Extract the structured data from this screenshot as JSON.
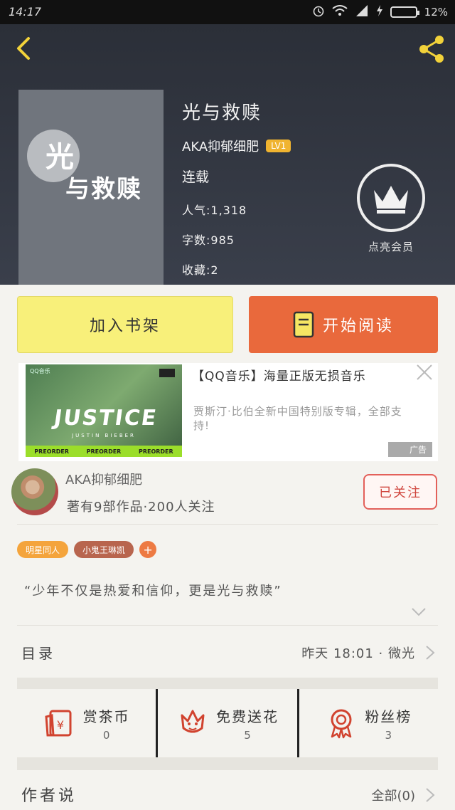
{
  "status_bar": {
    "time": "14:17",
    "battery": "12%"
  },
  "book": {
    "title": "光与救赎",
    "cover_line1": "光",
    "cover_line2": "与救赎",
    "author": "AKA抑郁细肥",
    "level": "LV1",
    "status": "连载",
    "popularity": "人气:1,318",
    "word_count": "字数:985",
    "favorites": "收藏:2"
  },
  "vip": {
    "label": "点亮会员"
  },
  "actions": {
    "add_shelf": "加入书架",
    "start_reading": "开始阅读"
  },
  "ad": {
    "title": "【QQ音乐】海量正版无损音乐",
    "description": "贾斯汀·比伯全新中国特别版专辑，全部支持!",
    "tag": "广告",
    "image_text": {
      "brand": "QQ音乐",
      "word": "JUSTICE",
      "artist": "JUSTIN BIEBER",
      "preorder": [
        "PREORDER",
        "PREORDER",
        "PREORDER"
      ]
    }
  },
  "author_card": {
    "name": "AKA抑郁细肥",
    "works": "著有9部作品·200人关注",
    "follow_label": "已关注"
  },
  "tags": [
    "明星同人",
    "小鬼王琳凯"
  ],
  "tag_add": "+",
  "quote": "“少年不仅是热爱和信仰，更是光与救赎”",
  "toc": {
    "label": "目录",
    "latest": "昨天 18:01 · 微光"
  },
  "stats": [
    {
      "label": "赏茶币",
      "value": "0",
      "icon": "red-envelope-icon"
    },
    {
      "label": "免费送花",
      "value": "5",
      "icon": "flower-icon"
    },
    {
      "label": "粉丝榜",
      "value": "3",
      "icon": "medal-icon"
    }
  ],
  "author_says": {
    "label": "作者说",
    "all": "全部(0)"
  },
  "colors": {
    "accent": "#e9693c",
    "shelf": "#f8f07a",
    "header": "#2f333d"
  }
}
